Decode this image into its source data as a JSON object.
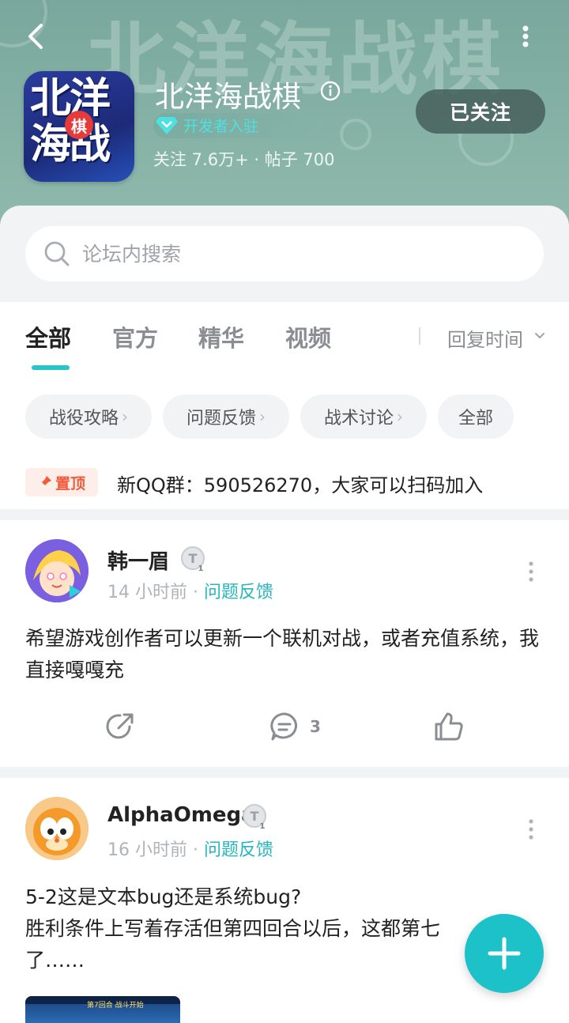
{
  "header": {
    "background_text": "北洋海战棋",
    "app_icon_text": "北洋海战",
    "app_icon_badge": "棋",
    "title": "北洋海战棋",
    "developer_badge": "开发者入驻",
    "stats": "关注 7.6万+ · 帖子 700",
    "follow_label": "已关注"
  },
  "search": {
    "placeholder": "论坛内搜索"
  },
  "tabs": [
    {
      "label": "全部",
      "active": true
    },
    {
      "label": "官方",
      "active": false
    },
    {
      "label": "精华",
      "active": false
    },
    {
      "label": "视频",
      "active": false
    }
  ],
  "sort": {
    "label": "回复时间"
  },
  "chips": [
    {
      "label": "战役攻略",
      "chevron": "›"
    },
    {
      "label": "问题反馈",
      "chevron": "›"
    },
    {
      "label": "战术讨论",
      "chevron": "›"
    },
    {
      "label": "全部",
      "chevron": ""
    }
  ],
  "pinned": {
    "badge": "置顶",
    "title": "新QQ群：590526270，大家可以扫码加入"
  },
  "posts": [
    {
      "username": "韩一眉",
      "time": "14 小时前",
      "separator": "·",
      "category": "问题反馈",
      "body": "希望游戏创作者可以更新一个联机对战，或者充值系统，我直接嘎嘎充",
      "comment_count": "3"
    },
    {
      "username": "AlphaOmega",
      "time": "16 小时前",
      "separator": "·",
      "category": "问题反馈",
      "body_line1": "5-2这是文本bug还是系统bug?",
      "body_line2": "胜利条件上写着存活但第四回合以后，这都第七",
      "body_line3": "了……",
      "thumb_text": "第7回合  战斗开始"
    }
  ],
  "colors": {
    "accent": "#27c4c8",
    "header_bg": "#86b2a6",
    "pin": "#f15a3a"
  }
}
